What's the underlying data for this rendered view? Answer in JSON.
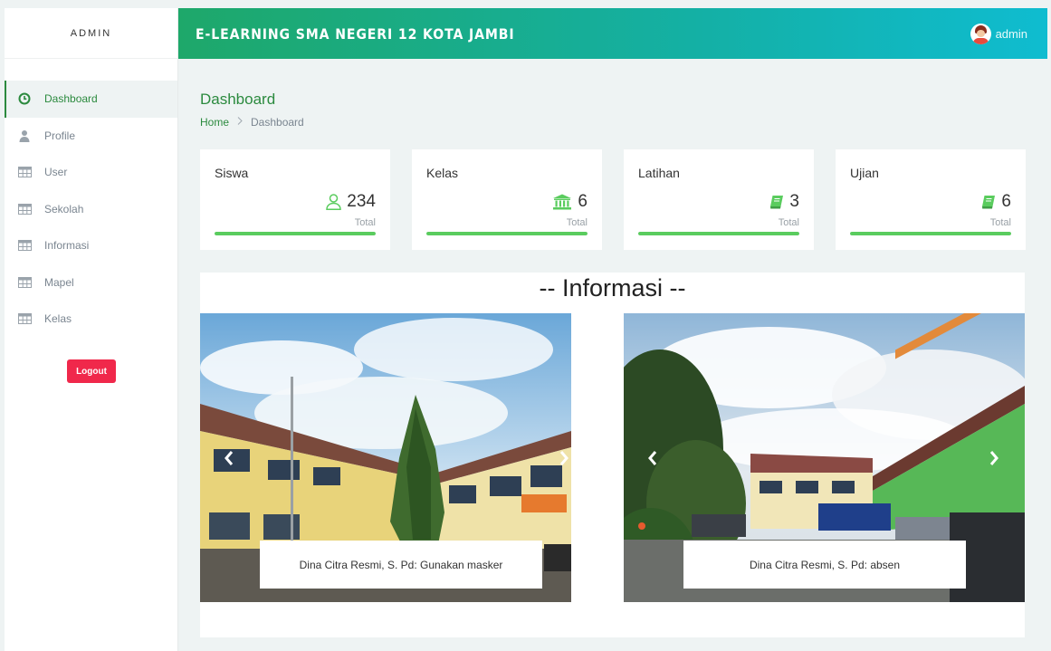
{
  "sidebar": {
    "brand": "ADMIN",
    "items": [
      {
        "label": "Dashboard",
        "icon": "clock-icon"
      },
      {
        "label": "Profile",
        "icon": "user-icon"
      },
      {
        "label": "User",
        "icon": "table-icon"
      },
      {
        "label": "Sekolah",
        "icon": "table-icon"
      },
      {
        "label": "Informasi",
        "icon": "table-icon"
      },
      {
        "label": "Mapel",
        "icon": "table-icon"
      },
      {
        "label": "Kelas",
        "icon": "table-icon"
      }
    ],
    "logout_label": "Logout"
  },
  "header": {
    "title": "E-LEARNING SMA NEGERI 12 KOTA JAMBI",
    "user_name": "admin"
  },
  "page": {
    "title": "Dashboard",
    "breadcrumb": {
      "home": "Home",
      "current": "Dashboard"
    }
  },
  "stats": [
    {
      "label": "Siswa",
      "value": "234",
      "sub": "Total",
      "icon": "user-outline-icon",
      "progress": 1.0
    },
    {
      "label": "Kelas",
      "value": "6",
      "sub": "Total",
      "icon": "institution-icon",
      "progress": 1.0
    },
    {
      "label": "Latihan",
      "value": "3",
      "sub": "Total",
      "icon": "book-icon",
      "progress": 1.0
    },
    {
      "label": "Ujian",
      "value": "6",
      "sub": "Total",
      "icon": "book-icon",
      "progress": 1.0
    }
  ],
  "info": {
    "title": "-- Informasi --",
    "slides": [
      {
        "caption": "Dina Citra Resmi, S. Pd: Gunakan masker"
      },
      {
        "caption": "Dina Citra Resmi, S. Pd: absen"
      }
    ]
  },
  "colors": {
    "accent": "#2b8a3e",
    "progress": "#5acc5e",
    "logout": "#f0284b",
    "header_start": "#1ea86a",
    "header_end": "#0fbcd0"
  }
}
